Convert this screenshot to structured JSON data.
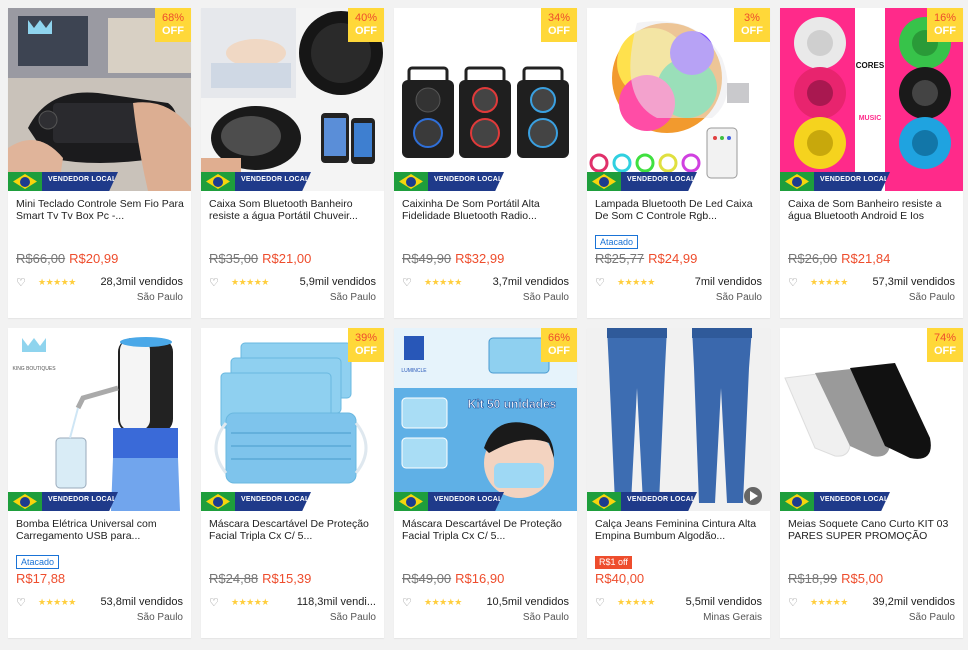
{
  "badge_label": "VENDEDOR LOCAL",
  "off_label": "OFF",
  "colors": {
    "accent": "#ee4d2d",
    "discount_bg": "#ffd839",
    "ribbon": "#1f3a8a"
  },
  "products": [
    {
      "title": "Mini Teclado Controle Sem Fio Para Smart Tv Tv Box Pc -...",
      "discount": "68%",
      "old_price": "R$66,00",
      "price": "R$20,99",
      "sold": "28,3mil vendidos",
      "location": "São Paulo",
      "tag": ""
    },
    {
      "title": "Caixa Som Bluetooth Banheiro resiste a água Portátil Chuveir...",
      "discount": "40%",
      "old_price": "R$35,00",
      "price": "R$21,00",
      "sold": "5,9mil vendidos",
      "location": "São Paulo",
      "tag": ""
    },
    {
      "title": "Caixinha De Som Portátil Alta Fidelidade Bluetooth Radio...",
      "discount": "34%",
      "old_price": "R$49,90",
      "price": "R$32,99",
      "sold": "3,7mil vendidos",
      "location": "São Paulo",
      "tag": ""
    },
    {
      "title": "Lampada Bluetooth De Led Caixa De Som C Controle Rgb...",
      "discount": "3%",
      "old_price": "R$25,77",
      "price": "R$24,99",
      "sold": "7mil vendidos",
      "location": "São Paulo",
      "tag": "Atacado"
    },
    {
      "title": "Caixa de Som Banheiro resiste a água Bluetooth Android E Ios",
      "discount": "16%",
      "old_price": "R$26,00",
      "price": "R$21,84",
      "sold": "57,3mil vendidos",
      "location": "São Paulo",
      "tag": ""
    },
    {
      "title": "Bomba Elétrica Universal com Carregamento USB para...",
      "discount": "",
      "old_price": "",
      "price": "R$17,88",
      "sold": "53,8mil vendidos",
      "location": "São Paulo",
      "tag": "Atacado"
    },
    {
      "title": "Máscara Descartável De Proteção Facial Tripla Cx C/ 5...",
      "discount": "39%",
      "old_price": "R$24,88",
      "price": "R$15,39",
      "sold": "118,3mil vendi...",
      "location": "São Paulo",
      "tag": ""
    },
    {
      "title": "Máscara Descartável De Proteção Facial Tripla Cx C/ 5...",
      "discount": "66%",
      "old_price": "R$49,00",
      "price": "R$16,90",
      "sold": "10,5mil vendidos",
      "location": "São Paulo",
      "tag": ""
    },
    {
      "title": "Calça Jeans Feminina Cintura Alta Empina Bumbum Algodão...",
      "discount": "",
      "old_price": "",
      "price": "R$40,00",
      "sold": "5,5mil vendidos",
      "location": "Minas Gerais",
      "tag": "R$1 off"
    },
    {
      "title": "Meias Soquete Cano Curto KIT 03 PARES SUPER PROMOÇÃO",
      "discount": "74%",
      "old_price": "R$18,99",
      "price": "R$5,00",
      "sold": "39,2mil vendidos",
      "location": "São Paulo",
      "tag": ""
    }
  ],
  "image_texts": {
    "kit_label": "Kit 50 unidades",
    "cores": "CORES",
    "music": "MUSIC",
    "brand_boutique": "KING BOUTIQUES",
    "brand_lumincle": "LUMINCLE"
  }
}
